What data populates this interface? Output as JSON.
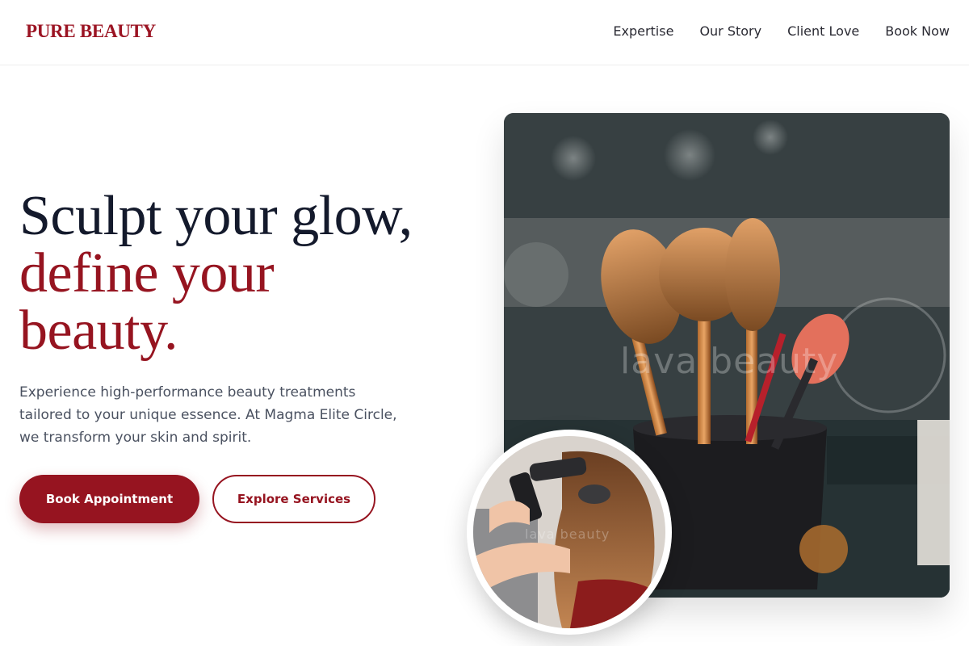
{
  "brand": {
    "name": "PURE BEAUTY"
  },
  "nav": {
    "links": [
      {
        "label": "Expertise"
      },
      {
        "label": "Our Story"
      },
      {
        "label": "Client Love"
      },
      {
        "label": "Book Now"
      }
    ]
  },
  "hero": {
    "title_line1": "Sculpt your glow,",
    "title_line2": "define your",
    "title_line3": "beauty.",
    "subtitle": "Experience high-performance beauty treatments tailored to your unique essence. At Magma Elite Circle, we transform your skin and spirit.",
    "primary_cta": "Book Appointment",
    "secondary_cta": "Explore Services"
  },
  "images": {
    "main_watermark": "lava beauty",
    "circle_watermark": "lava beauty"
  },
  "colors": {
    "accent": "#961420",
    "heading": "#141a2c",
    "body_text": "#4a5160"
  }
}
